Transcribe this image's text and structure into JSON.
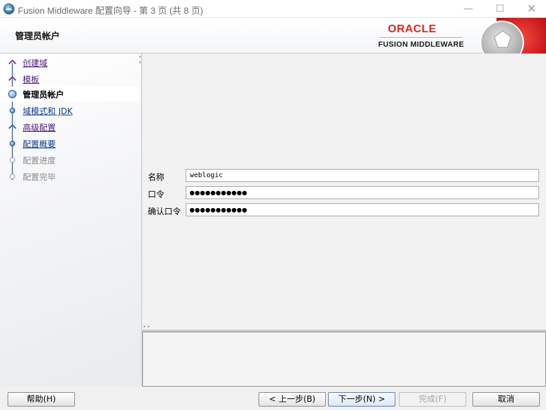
{
  "window": {
    "title": "Fusion Middleware 配置向导 - 第 3 页 (共 8 页)",
    "minimize": "—",
    "maximize": "☐",
    "close": "✕"
  },
  "header": {
    "page_title": "管理员帐户",
    "brand_name": "ORACLE",
    "product_name": "FUSION MIDDLEWARE"
  },
  "steps": [
    {
      "label": "创建域",
      "state": "visited"
    },
    {
      "label": "模板",
      "state": "visited"
    },
    {
      "label": "管理员帐户",
      "state": "current"
    },
    {
      "label": "域模式和 JDK",
      "state": "link"
    },
    {
      "label": "高级配置",
      "state": "visited"
    },
    {
      "label": "配置概要",
      "state": "link"
    },
    {
      "label": "配置进度",
      "state": "pending"
    },
    {
      "label": "配置完毕",
      "state": "pending"
    }
  ],
  "form": {
    "name_label": "名称",
    "name_value": "weblogic",
    "password_label": "口令",
    "password_value": "●●●●●●●●●●●",
    "confirm_label": "确认口令",
    "confirm_value": "●●●●●●●●●●●"
  },
  "buttons": {
    "help": "帮助(H)",
    "back": "< 上一步(B)",
    "next": "下一步(N) >",
    "finish": "完成(F)",
    "cancel": "取消"
  },
  "colors": {
    "brand_red": "#e2241b",
    "visited_link": "#4a1b7a",
    "link": "#123c8a",
    "step_node": "#2d6fb9"
  }
}
